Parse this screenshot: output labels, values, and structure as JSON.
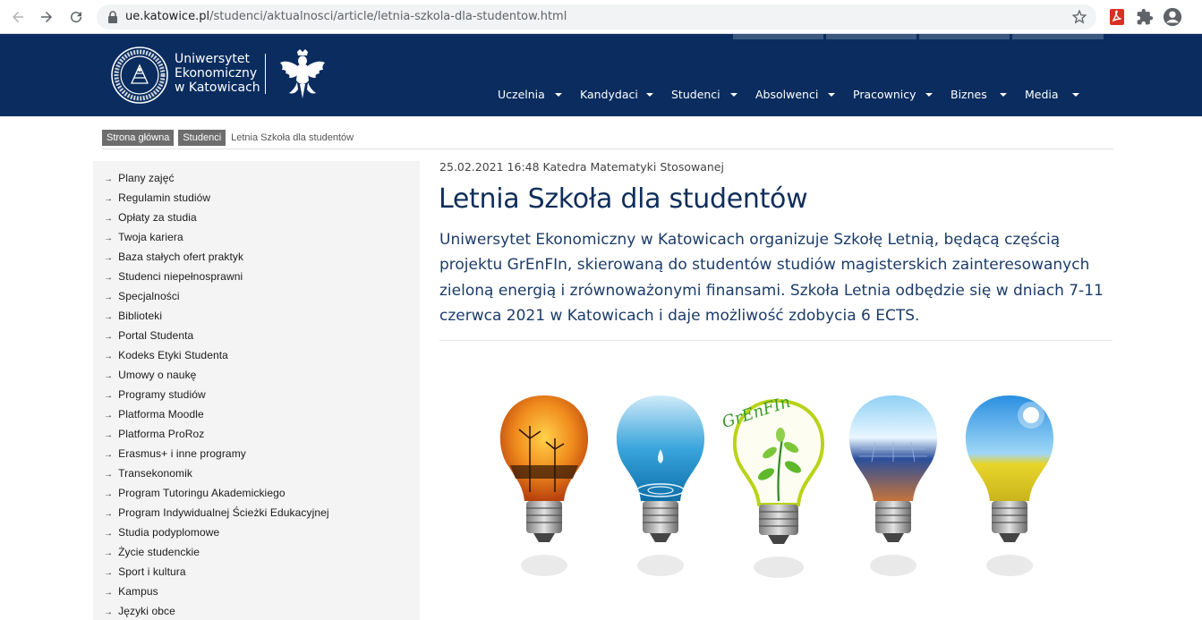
{
  "browser": {
    "url_host": "ue.katowice.pl",
    "url_path": "/studenci/aktualnosci/article/letnia-szkola-dla-studentow.html"
  },
  "header": {
    "logo_lines": [
      "Uniwersytet",
      "Ekonomiczny",
      "w Katowicach"
    ],
    "nav": [
      "Uczelnia",
      "Kandydaci",
      "Studenci",
      "Absolwenci",
      "Pracownicy",
      "Biznes",
      "Media"
    ]
  },
  "breadcrumb": {
    "items": [
      "Strona główna",
      "Studenci"
    ],
    "current": "Letnia Szkoła dla studentów"
  },
  "sidebar": {
    "items": [
      "Plany zajęć",
      "Regulamin studiów",
      "Opłaty za studia",
      "Twoja kariera",
      "Baza stałych ofert praktyk",
      "Studenci niepełnosprawni",
      "Specjalności",
      "Biblioteki",
      "Portal Studenta",
      "Kodeks Etyki Studenta",
      "Umowy o naukę",
      "Programy studiów",
      "Platforma Moodle",
      "Platforma ProRoz",
      "Erasmus+ i inne programy",
      "Transekonomik",
      "Program Tutoringu Akademickiego",
      "Program Indywidualnej Ścieżki Edukacyjnej",
      "Studia podyplomowe",
      "Życie studenckie",
      "Sport i kultura",
      "Kampus",
      "Języki obce"
    ]
  },
  "article": {
    "meta": "25.02.2021 16:48 Katedra Matematyki Stosowanej",
    "title": "Letnia Szkoła dla studentów",
    "lead": "Uniwersytet Ekonomiczny w Katowicach organizuje Szkołę Letnią, będącą częścią projektu GrEnFIn, skierowaną do studentów studiów magisterskich zainteresowanych zieloną energią i zrównoważonymi finansami. Szkoła Letnia odbędzie się w dniach 7-11 czerwca 2021 w Katowicach i daje możliwość zdobycia 6 ECTS.",
    "image_logo_text": "GrEnFIn"
  },
  "colors": {
    "header_bg": "#0a2c5e",
    "title": "#0f2e5a",
    "breadcrumb_bg": "#6d6d6d",
    "sidebar_bg": "#f4f4f4"
  },
  "icons": [
    "back-icon",
    "forward-icon",
    "reload-icon",
    "lock-icon",
    "star-icon",
    "pdf-icon",
    "extensions-icon",
    "profile-icon",
    "university-seal-logo",
    "polish-eagle-logo",
    "caret-down-icon",
    "arrow-right-icon"
  ]
}
